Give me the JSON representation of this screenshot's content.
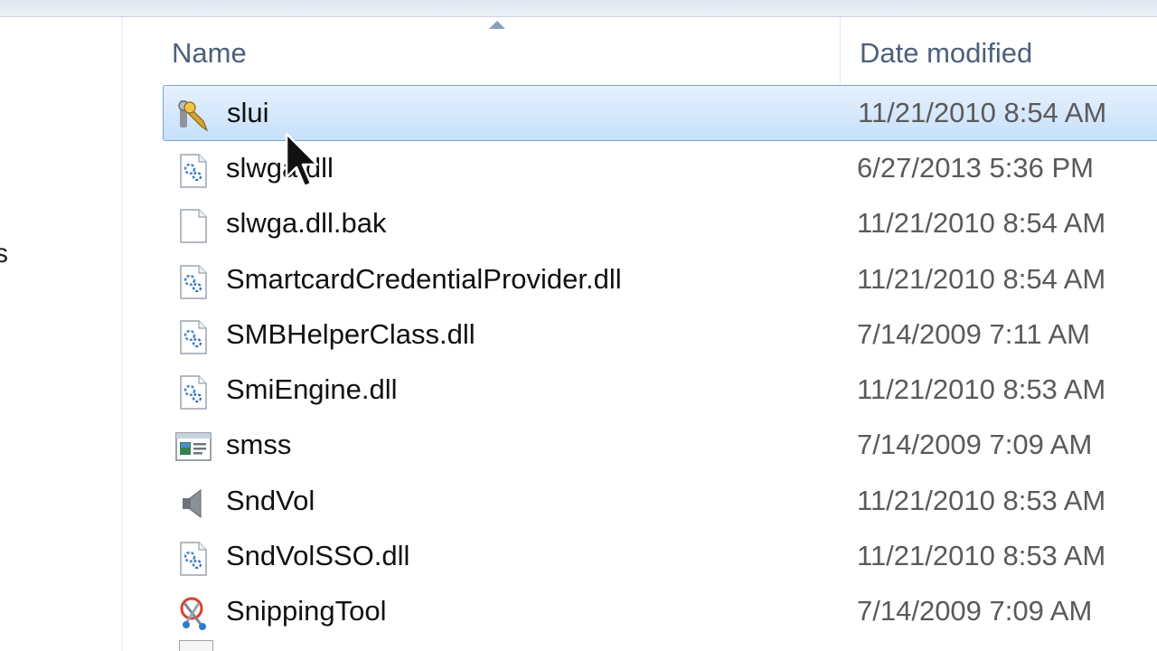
{
  "columns": {
    "name": "Name",
    "date_modified": "Date modified"
  },
  "nav_fragment": "s",
  "files": [
    {
      "name": "slui",
      "date": "11/21/2010 8:54 AM",
      "icon": "key-app-icon",
      "selected": true
    },
    {
      "name": "slwga.dll",
      "date": "6/27/2013 5:36 PM",
      "icon": "dll-gear-icon",
      "selected": false
    },
    {
      "name": "slwga.dll.bak",
      "date": "11/21/2010 8:54 AM",
      "icon": "blank-file-icon",
      "selected": false
    },
    {
      "name": "SmartcardCredentialProvider.dll",
      "date": "11/21/2010 8:54 AM",
      "icon": "dll-gear-icon",
      "selected": false
    },
    {
      "name": "SMBHelperClass.dll",
      "date": "7/14/2009 7:11 AM",
      "icon": "dll-gear-icon",
      "selected": false
    },
    {
      "name": "SmiEngine.dll",
      "date": "11/21/2010 8:53 AM",
      "icon": "dll-gear-icon",
      "selected": false
    },
    {
      "name": "smss",
      "date": "7/14/2009 7:09 AM",
      "icon": "app-window-icon",
      "selected": false
    },
    {
      "name": "SndVol",
      "date": "11/21/2010 8:53 AM",
      "icon": "speaker-icon",
      "selected": false
    },
    {
      "name": "SndVolSSO.dll",
      "date": "11/21/2010 8:53 AM",
      "icon": "dll-gear-icon",
      "selected": false
    },
    {
      "name": "SnippingTool",
      "date": "7/14/2009 7:09 AM",
      "icon": "scissors-icon",
      "selected": false
    }
  ],
  "colors": {
    "selection_border": "#7da2ce",
    "header_text": "#4c607a",
    "date_text": "#5a5a5a"
  }
}
